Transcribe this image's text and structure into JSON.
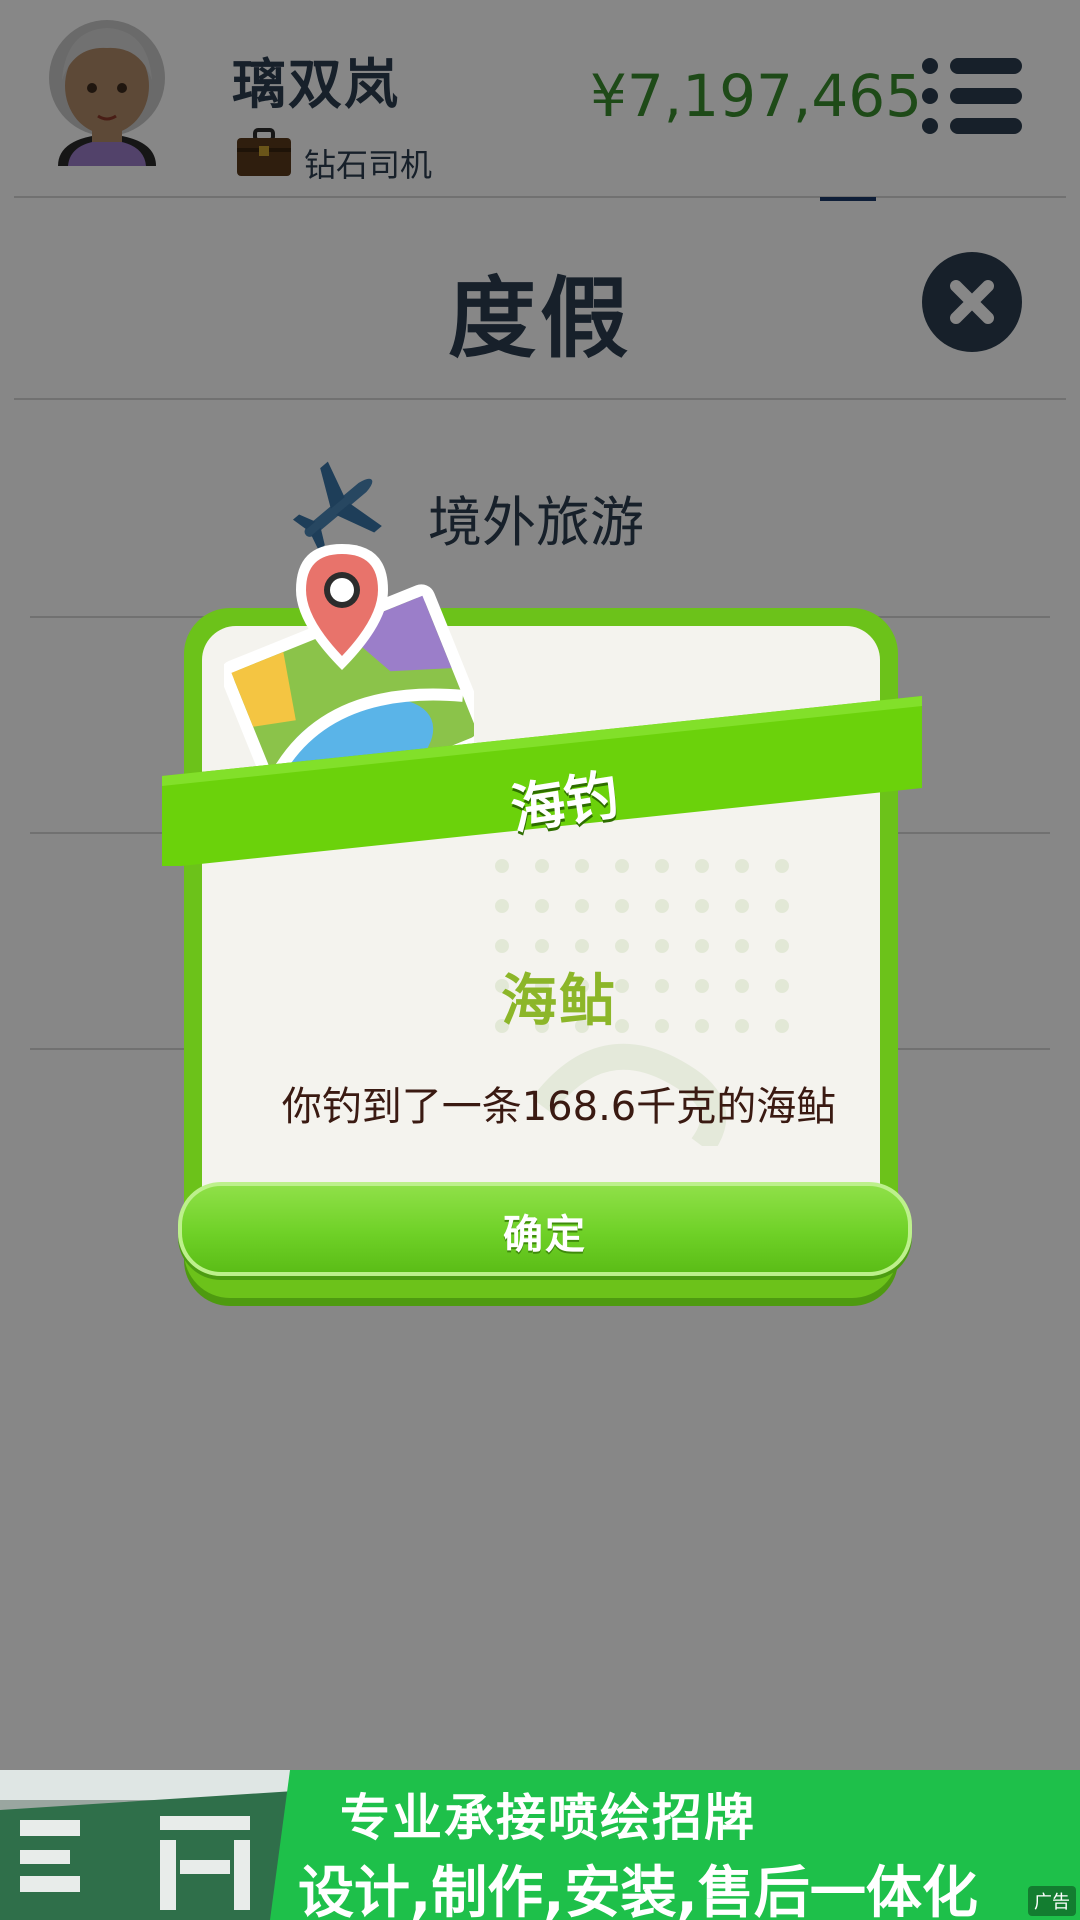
{
  "header": {
    "player_name": "璃双岚",
    "player_title": "钻石司机",
    "money": "¥7,197,465"
  },
  "page": {
    "title": "度假"
  },
  "travel_item": {
    "label": "境外旅游"
  },
  "dialog": {
    "banner_title": "海钓",
    "fish_name": "海鲇",
    "message": "你钓到了一条168.6千克的海鲇",
    "confirm_label": "确定"
  },
  "ad": {
    "line1": "专业承接喷绘招牌",
    "line2": "设计,制作,安装,售后一体化",
    "tag": "广告"
  },
  "colors": {
    "header_text": "#2c3e50",
    "money": "#3a8d2e",
    "dialog_green": "#6cc21a",
    "fish_name": "#8cb629",
    "ad_background": "#1ec04a"
  },
  "icons": [
    "avatar-icon",
    "briefcase-icon",
    "menu-icon",
    "close-icon",
    "plane-icon",
    "map-pin-icon"
  ]
}
